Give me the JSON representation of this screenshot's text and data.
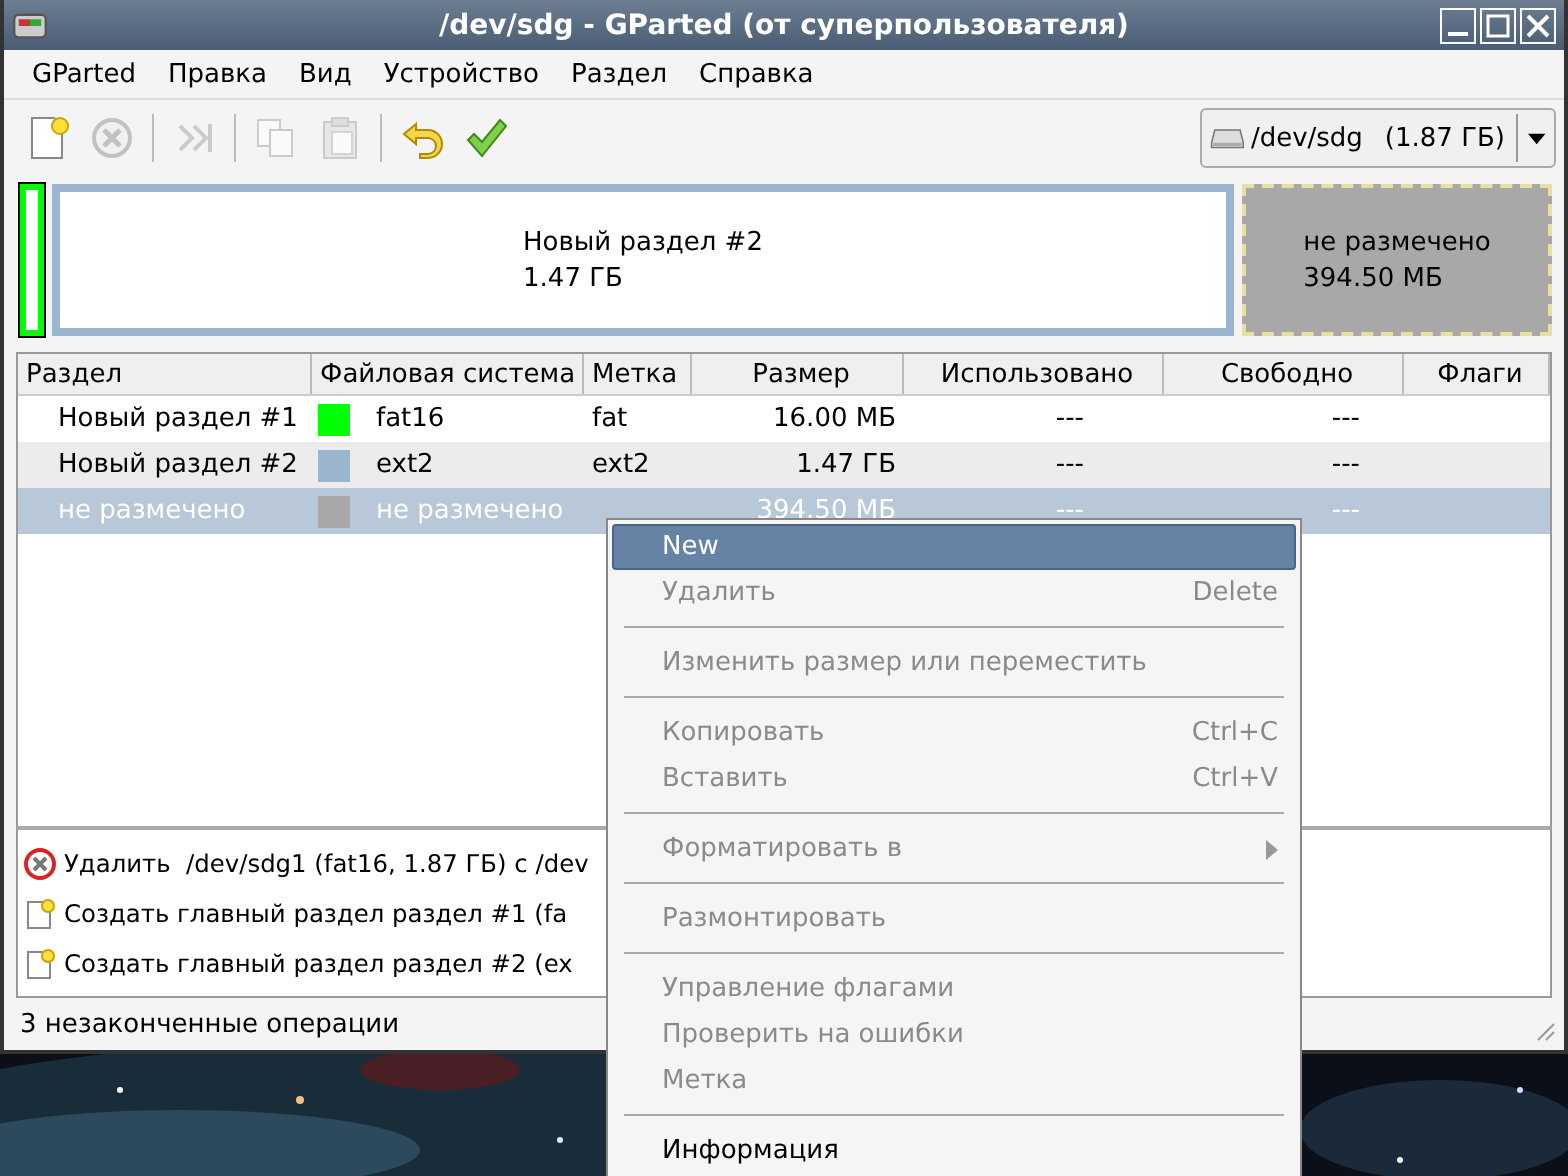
{
  "window": {
    "title": "/dev/sdg - GParted (от суперпользователя)"
  },
  "menubar": [
    "GParted",
    "Правка",
    "Вид",
    "Устройство",
    "Раздел",
    "Справка"
  ],
  "toolbar": [
    {
      "kind": "new",
      "disabled": false
    },
    {
      "kind": "delete",
      "disabled": true
    },
    {
      "kind": "sep"
    },
    {
      "kind": "resize",
      "disabled": true
    },
    {
      "kind": "sep"
    },
    {
      "kind": "copy",
      "disabled": true
    },
    {
      "kind": "paste",
      "disabled": true
    },
    {
      "kind": "sep"
    },
    {
      "kind": "undo",
      "disabled": false
    },
    {
      "kind": "apply",
      "disabled": false
    }
  ],
  "device": {
    "name": "/dev/sdg",
    "size": "(1.87 ГБ)"
  },
  "graph": [
    {
      "kind": "partition",
      "color": "#00ff00"
    },
    {
      "kind": "partition",
      "color": "#99b5d0",
      "name": "Новый раздел #2",
      "size": "1.47 ГБ"
    },
    {
      "kind": "unallocated",
      "color": "#a8a8a8",
      "name": "не размечено",
      "size": "394.50 МБ"
    }
  ],
  "table": {
    "columns": [
      "Раздел",
      "Файловая система",
      "Метка",
      "Размер",
      "Использовано",
      "Свободно",
      "Флаги"
    ],
    "rows": [
      {
        "partition": "Новый раздел #1",
        "color": "#00ff00",
        "fs": "fat16",
        "label": "fat",
        "size": "16.00 МБ",
        "used": "---",
        "free": "---",
        "selected": false
      },
      {
        "partition": "Новый раздел #2",
        "color": "#99b5d0",
        "fs": "ext2",
        "label": "ext2",
        "size": "1.47 ГБ",
        "used": "---",
        "free": "---",
        "selected": false
      },
      {
        "partition": "не размечено",
        "color": "#a8a8a8",
        "fs": "не размечено",
        "size": "394.50 МБ",
        "used": "---",
        "free": "---",
        "selected": true
      }
    ]
  },
  "operations": [
    {
      "kind": "delete",
      "text": "Удалить  /dev/sdg1 (fat16, 1.87 ГБ) с /dev"
    },
    {
      "kind": "create",
      "text": "Создать главный раздел раздел #1 (fa"
    },
    {
      "kind": "create",
      "text": "Создать главный раздел раздел #2 (ex"
    }
  ],
  "status_bar": "3 незаконченные операции",
  "context_menu": [
    {
      "kind": "item",
      "label": "New",
      "disabled": false,
      "selected": true
    },
    {
      "kind": "item",
      "label": "Удалить",
      "shortcut": "Delete",
      "disabled": true,
      "selected": false
    },
    {
      "kind": "separator"
    },
    {
      "kind": "item",
      "label": "Изменить размер или переместить",
      "disabled": true,
      "selected": false
    },
    {
      "kind": "separator"
    },
    {
      "kind": "item",
      "label": "Копировать",
      "shortcut": "Ctrl+C",
      "disabled": true,
      "selected": false
    },
    {
      "kind": "item",
      "label": "Вставить",
      "shortcut": "Ctrl+V",
      "disabled": true,
      "selected": false
    },
    {
      "kind": "separator"
    },
    {
      "kind": "submenu",
      "label": "Форматировать в",
      "disabled": true,
      "selected": false
    },
    {
      "kind": "separator"
    },
    {
      "kind": "item",
      "label": "Размонтировать",
      "disabled": true,
      "selected": false
    },
    {
      "kind": "separator"
    },
    {
      "kind": "item",
      "label": "Управление флагами",
      "disabled": true,
      "selected": false
    },
    {
      "kind": "item",
      "label": "Проверить на ошибки",
      "disabled": true,
      "selected": false
    },
    {
      "kind": "item",
      "label": "Метка",
      "disabled": true,
      "selected": false
    },
    {
      "kind": "separator"
    },
    {
      "kind": "item",
      "label": "Информация",
      "disabled": false,
      "selected": false
    }
  ]
}
